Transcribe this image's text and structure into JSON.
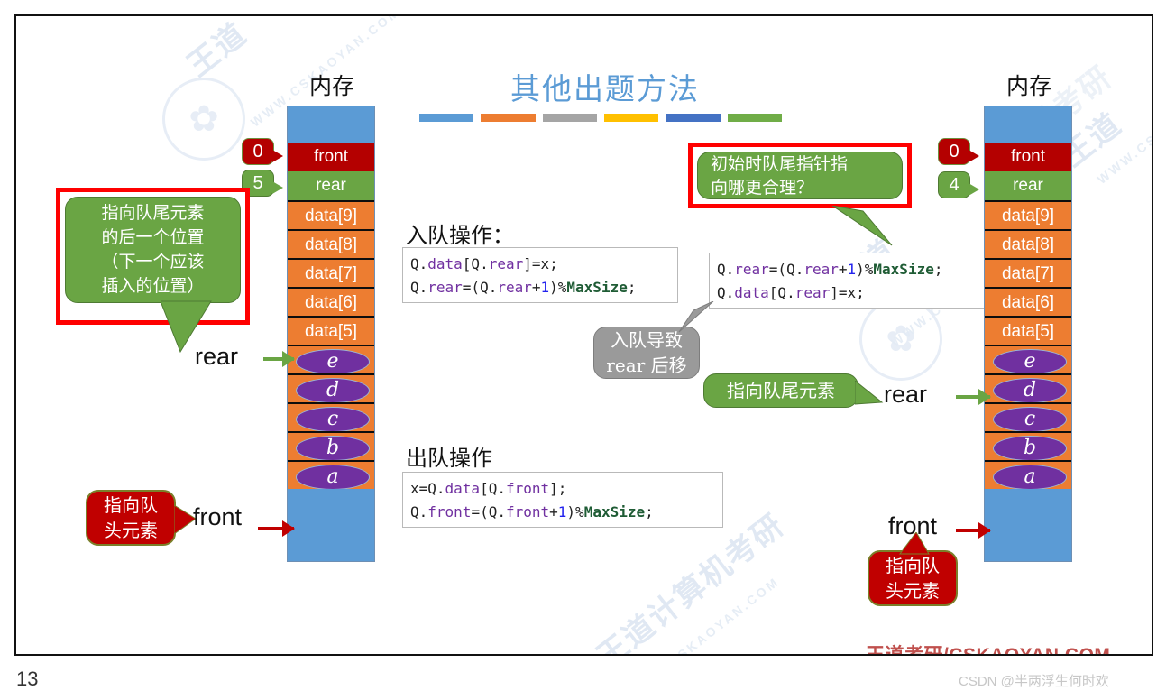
{
  "slide": {
    "title": "其他出题方法",
    "title_bar_colors": [
      "#5b9bd5",
      "#ed7d31",
      "#a5a5a5",
      "#ffc000",
      "#4472c4",
      "#70ad47"
    ],
    "page_number": "13",
    "brand": "王道考研/CSKAOYAN.COM",
    "watermark_primary": "王道计算机考研",
    "watermark_url": "WWW.CSKAOYAN.COM",
    "csdn_credit": "CSDN @半两浮生何时欢"
  },
  "left_diagram": {
    "caption": "内存",
    "front_cell": "front",
    "rear_cell": "rear",
    "front_index_tag": "0",
    "rear_index_tag": "5",
    "data_cells": [
      "data[9]",
      "data[8]",
      "data[7]",
      "data[6]",
      "data[5]"
    ],
    "element_cells": [
      "e",
      "d",
      "c",
      "b",
      "a"
    ],
    "rear_pointer_label": "rear",
    "front_pointer_label": "front",
    "rear_callout": "指向队尾元素的后一个位置（下一个应该插入的位置）",
    "rear_callout_lines": [
      "指向队尾元素",
      "的后一个位置",
      "（下一个应该",
      "插入的位置）"
    ],
    "front_callout_lines": [
      "指向队",
      "头元素"
    ]
  },
  "right_diagram": {
    "caption": "内存",
    "front_cell": "front",
    "rear_cell": "rear",
    "front_index_tag": "0",
    "rear_index_tag": "4",
    "data_cells": [
      "data[9]",
      "data[8]",
      "data[7]",
      "data[6]",
      "data[5]"
    ],
    "element_cells": [
      "e",
      "d",
      "c",
      "b",
      "a"
    ],
    "rear_pointer_label": "rear",
    "front_pointer_label": "front",
    "rear_callout": "指向队尾元素",
    "front_callout_lines": [
      "指向队",
      "头元素"
    ]
  },
  "center": {
    "enqueue_heading": "入队操作：",
    "enqueue_code_left": [
      [
        {
          "t": "Q.",
          "c": "df"
        },
        {
          "t": "data",
          "c": "pl"
        },
        {
          "t": "[Q.",
          "c": "df"
        },
        {
          "t": "rear",
          "c": "pl"
        },
        {
          "t": "]=x;",
          "c": "df"
        }
      ],
      [
        {
          "t": "Q.",
          "c": "df"
        },
        {
          "t": "rear",
          "c": "pl"
        },
        {
          "t": "=(Q.",
          "c": "df"
        },
        {
          "t": "rear",
          "c": "pl"
        },
        {
          "t": "+",
          "c": "df"
        },
        {
          "t": "1",
          "c": "nu"
        },
        {
          "t": ")%",
          "c": "df"
        },
        {
          "t": "MaxSize",
          "c": "id"
        },
        {
          "t": ";",
          "c": "df"
        }
      ]
    ],
    "enqueue_code_right": [
      [
        {
          "t": "Q.",
          "c": "df"
        },
        {
          "t": "rear",
          "c": "pl"
        },
        {
          "t": "=(Q.",
          "c": "df"
        },
        {
          "t": "rear",
          "c": "pl"
        },
        {
          "t": "+",
          "c": "df"
        },
        {
          "t": "1",
          "c": "nu"
        },
        {
          "t": ")%",
          "c": "df"
        },
        {
          "t": "MaxSize",
          "c": "id"
        },
        {
          "t": ";",
          "c": "df"
        }
      ],
      [
        {
          "t": "Q.",
          "c": "df"
        },
        {
          "t": "data",
          "c": "pl"
        },
        {
          "t": "[Q.",
          "c": "df"
        },
        {
          "t": "rear",
          "c": "pl"
        },
        {
          "t": "]=x;",
          "c": "df"
        }
      ]
    ],
    "dequeue_heading": "出队操作",
    "dequeue_code": [
      [
        {
          "t": "x=Q.",
          "c": "df"
        },
        {
          "t": "data",
          "c": "pl"
        },
        {
          "t": "[Q.",
          "c": "df"
        },
        {
          "t": "front",
          "c": "pl"
        },
        {
          "t": "];",
          "c": "df"
        }
      ],
      [
        {
          "t": "Q.",
          "c": "df"
        },
        {
          "t": "front",
          "c": "pl"
        },
        {
          "t": "=(Q.",
          "c": "df"
        },
        {
          "t": "front",
          "c": "pl"
        },
        {
          "t": "+",
          "c": "df"
        },
        {
          "t": "1",
          "c": "nu"
        },
        {
          "t": ")%",
          "c": "df"
        },
        {
          "t": "MaxSize",
          "c": "id"
        },
        {
          "t": ";",
          "c": "df"
        }
      ]
    ],
    "gray_callout_lines": [
      "入队导致",
      "rear 后移"
    ],
    "question_callout_lines": [
      "初始时队尾指针指",
      "向哪更合理？"
    ]
  }
}
